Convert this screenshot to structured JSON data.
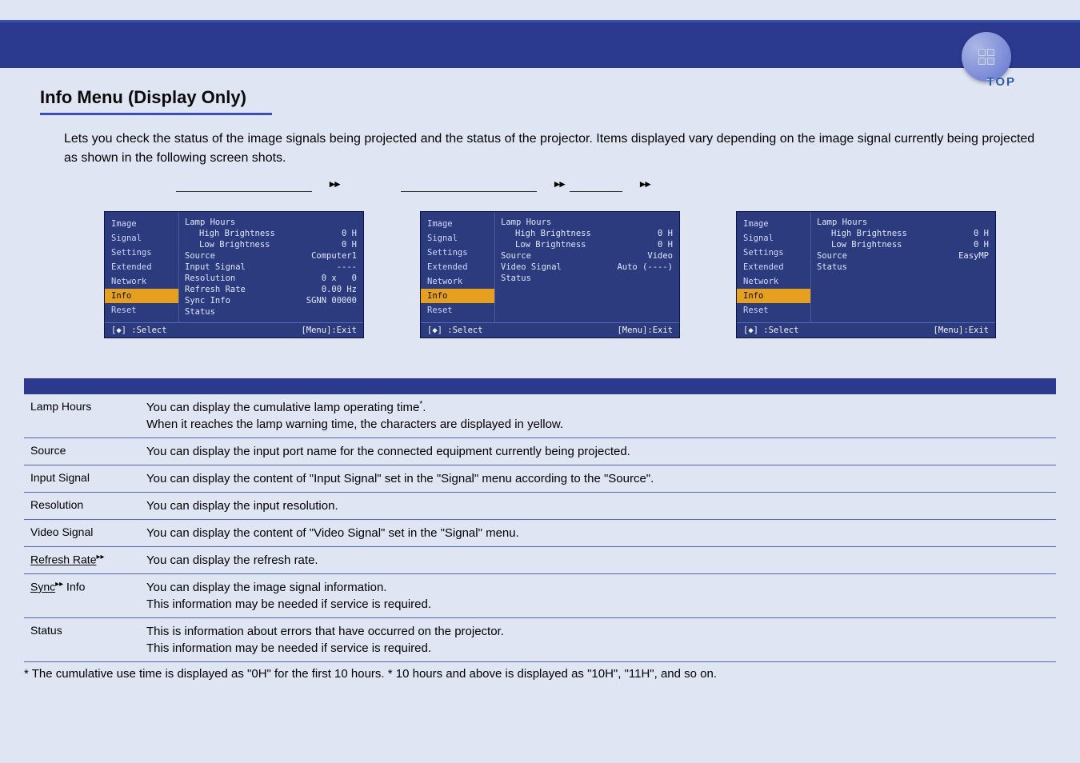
{
  "top_label": "TOP",
  "title": "Info Menu (Display Only)",
  "intro": "Lets you check the status of the image signals being projected and the status of the projector. Items displayed vary depending on the image signal currently being projected as shown in the following screen shots.",
  "glossary_sym": "▸▸",
  "osd_menu": [
    "Image",
    "Signal",
    "Settings",
    "Extended",
    "Network",
    "Info",
    "Reset"
  ],
  "osd_selected": "Info",
  "osd_footer": {
    "left": "[◆] :Select",
    "right": "[Menu]:Exit"
  },
  "screens": [
    {
      "rows": [
        {
          "k": "Lamp Hours",
          "v": ""
        },
        {
          "k": "High Brightness",
          "v": "0 H",
          "indent": true
        },
        {
          "k": "Low Brightness",
          "v": "0 H",
          "indent": true
        },
        {
          "k": "Source",
          "v": "Computer1"
        },
        {
          "k": "Input Signal",
          "v": "----"
        },
        {
          "k": "Resolution",
          "v": "0 x   0"
        },
        {
          "k": "Refresh Rate",
          "v": "0.00 Hz"
        },
        {
          "k": "Sync Info",
          "v": "SGNN 00000"
        },
        {
          "k": "Status",
          "v": ""
        }
      ]
    },
    {
      "rows": [
        {
          "k": "Lamp Hours",
          "v": ""
        },
        {
          "k": "High Brightness",
          "v": "0 H",
          "indent": true
        },
        {
          "k": "Low Brightness",
          "v": "0 H",
          "indent": true
        },
        {
          "k": "Source",
          "v": "Video"
        },
        {
          "k": "Video Signal",
          "v": "Auto (----)"
        },
        {
          "k": "Status",
          "v": ""
        }
      ]
    },
    {
      "rows": [
        {
          "k": "Lamp Hours",
          "v": ""
        },
        {
          "k": "High Brightness",
          "v": "0 H",
          "indent": true
        },
        {
          "k": "Low Brightness",
          "v": "0 H",
          "indent": true
        },
        {
          "k": "Source",
          "v": "EasyMP"
        },
        {
          "k": "Status",
          "v": ""
        }
      ]
    }
  ],
  "subs": [
    {
      "name": "Lamp Hours",
      "desc": "You can display the cumulative lamp operating time*.\nWhen it reaches the lamp warning time, the characters are displayed in yellow.",
      "star": true
    },
    {
      "name": "Source",
      "desc": "You can display the input port name for the connected equipment currently being projected."
    },
    {
      "name": "Input Signal",
      "desc": "You can display the content of \"Input Signal\" set in the \"Signal\" menu according to the \"Source\"."
    },
    {
      "name": "Resolution",
      "desc": "You can display the input resolution."
    },
    {
      "name": "Video Signal",
      "desc": "You can display the content of \"Video Signal\" set in the \"Signal\" menu."
    },
    {
      "name": "Refresh Rate",
      "desc": "You can display the refresh rate.",
      "gloss": true
    },
    {
      "name": "Sync Info",
      "desc": "You can display the image signal information.\nThis information may be needed if service is required.",
      "gloss": true,
      "info": true
    },
    {
      "name": "Status",
      "desc": "This is information about errors that have occurred on the projector. \nThis information may be needed if service is required."
    }
  ],
  "labels": {
    "refresh": "Refresh Rate",
    "sync": "Sync",
    "sync_info": " Info"
  },
  "footnote": "* The cumulative use time is displayed as \"0H\" for the first 10 hours. * 10 hours and above is displayed as \"10H\", \"11H\", and so on."
}
